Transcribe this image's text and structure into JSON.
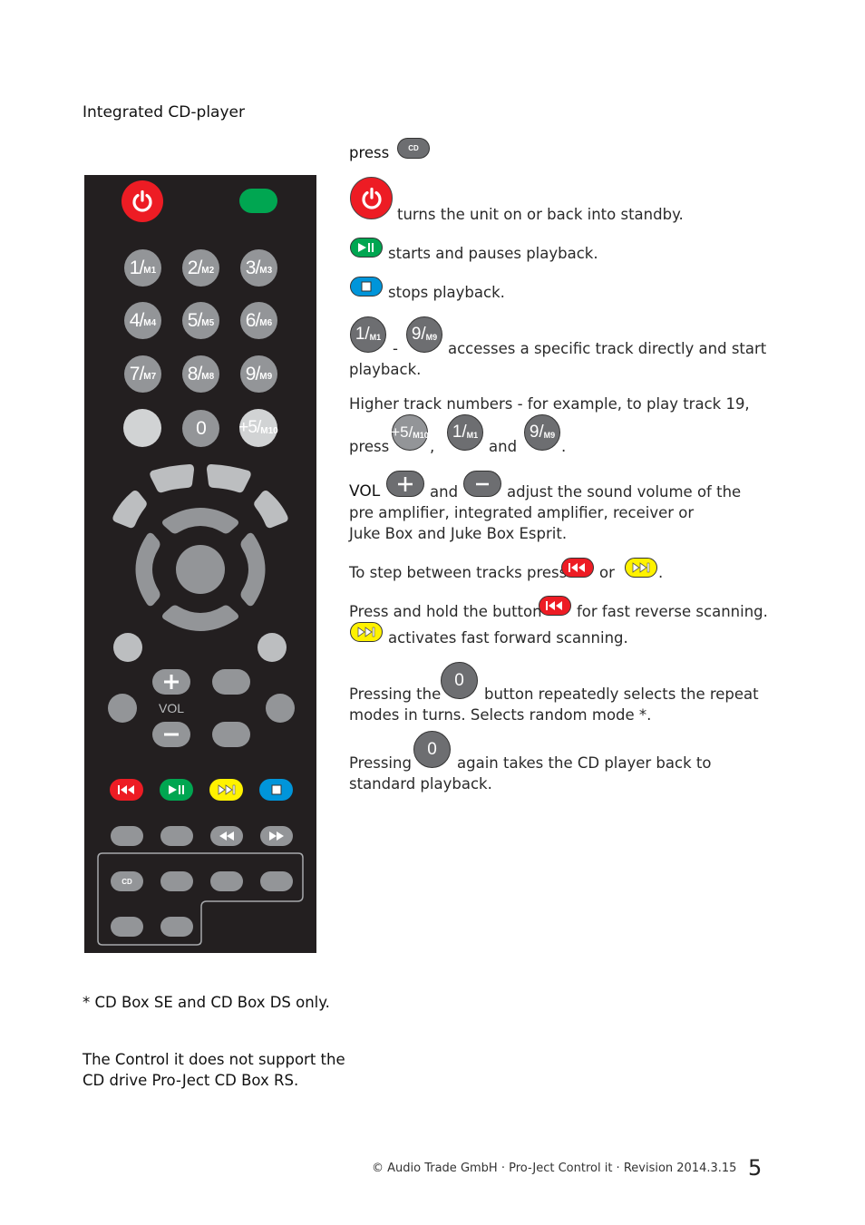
{
  "heading": "Integrated CD-player",
  "remote": {
    "numpad": [
      {
        "main": "1/",
        "sub": "M1"
      },
      {
        "main": "2/",
        "sub": "M2"
      },
      {
        "main": "3/",
        "sub": "M3"
      },
      {
        "main": "4/",
        "sub": "M4"
      },
      {
        "main": "5/",
        "sub": "M5"
      },
      {
        "main": "6/",
        "sub": "M6"
      },
      {
        "main": "7/",
        "sub": "M7"
      },
      {
        "main": "8/",
        "sub": "M8"
      },
      {
        "main": "9/",
        "sub": "M9"
      }
    ],
    "zero": "0",
    "plus5": {
      "main": "+5/",
      "sub": "M10"
    },
    "vol_label": "VOL",
    "cd_label": "CD",
    "colors": {
      "power": "#ed1c24",
      "green": "#00a651",
      "yellow": "#fff200",
      "blue": "#0095da",
      "red": "#ed1c24"
    }
  },
  "instructions": {
    "press_cd_prefix": "press",
    "cd_button_label": "CD",
    "power_text": "turns the unit on or back into standby.",
    "play_text": "starts and pauses playback.",
    "stop_text": "stops playback.",
    "track_range_dash": "-",
    "track_text_1": "accesses a specific track directly and start",
    "track_text_2": "playback.",
    "higher_text": "Higher track numbers - for example, to play track 19,",
    "higher_press": "press",
    "comma": ",",
    "and1": "and",
    "period": ".",
    "btn_1": {
      "main": "1/",
      "sub": "M1"
    },
    "btn_9": {
      "main": "9/",
      "sub": "M9"
    },
    "btn_plus5": {
      "main": "+5/",
      "sub": "M10"
    },
    "vol_prefix": "VOL",
    "vol_and": "and",
    "vol_text_1": "adjust the sound volume of the",
    "vol_text_2": "pre amplifier, integrated amplifier, receiver or",
    "vol_text_3": "Juke Box and Juke Box Esprit.",
    "step_text": "To step between tracks press",
    "step_or": "or",
    "step_period": ".",
    "hold_text_1": "Press and hold the button",
    "hold_text_2": "for fast reverse scanning.",
    "ff_text": "activates fast forward scanning.",
    "repeat_1a": "Pressing the",
    "repeat_1b": "button repeatedly selects the repeat",
    "repeat_2": "modes in turns. Selects random mode *.",
    "zero_label": "0",
    "again_1a": "Pressing",
    "again_1b": "again takes the CD player back to",
    "again_2": "standard playback."
  },
  "notes": {
    "footnote": "* CD Box SE and CD Box DS only.",
    "unsupported_1": "The Control it does not support the",
    "unsupported_2": "CD drive Pro-Ject CD Box RS."
  },
  "footer": {
    "text": "© Audio Trade GmbH · Pro-Ject Control it · Revision 2014.3.15",
    "page_number": "5"
  }
}
